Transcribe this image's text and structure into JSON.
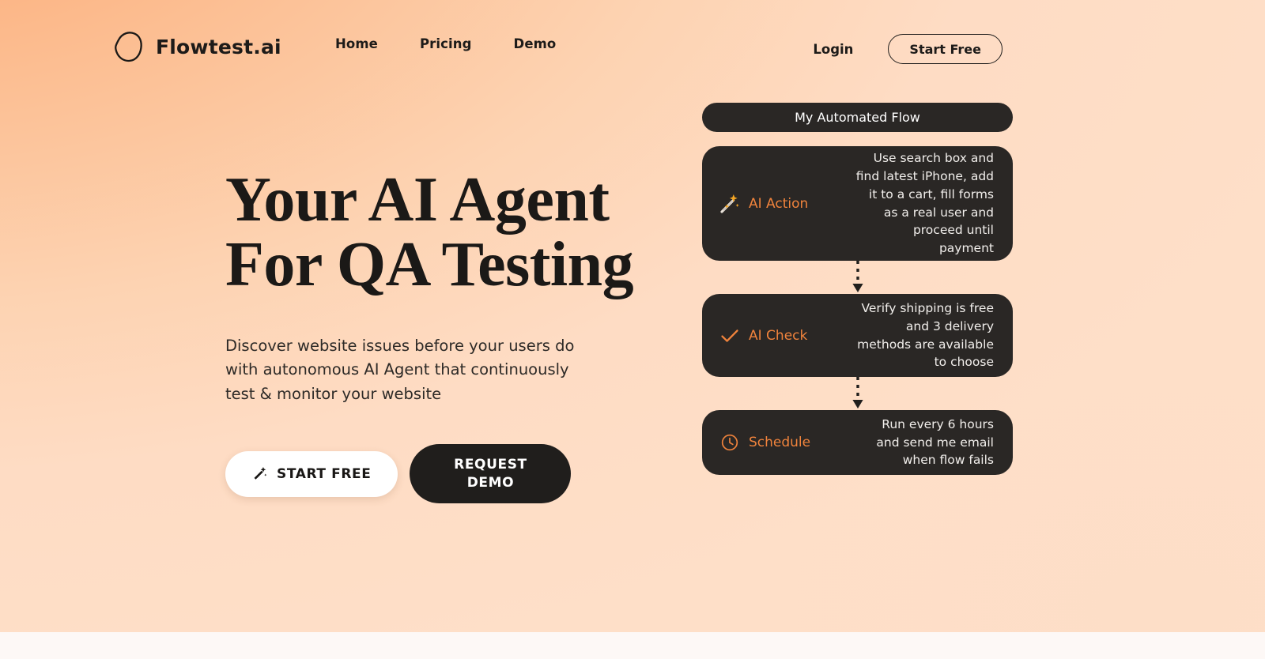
{
  "brand": {
    "name": "Flowtest.ai",
    "logo_icon": "blob-logo-icon"
  },
  "nav": {
    "items": [
      {
        "label": "Home"
      },
      {
        "label": "Pricing"
      },
      {
        "label": "Demo"
      }
    ],
    "login_label": "Login",
    "start_free_label": "Start Free"
  },
  "hero": {
    "headline_line1": "Your AI Agent",
    "headline_line2": "For QA Testing",
    "subhead": "Discover website issues before your users do with autonomous AI Agent that continuously test & monitor your website",
    "primary_cta": {
      "label": "START FREE",
      "icon": "magic-wand-icon"
    },
    "secondary_cta": {
      "label_line1": "REQUEST",
      "label_line2": "DEMO"
    }
  },
  "flow": {
    "title": "My Automated Flow",
    "nodes": [
      {
        "icon": "magic-wand-icon",
        "label": "AI Action",
        "description": "Use search box and find latest iPhone, add it to a cart, fill forms as a real user and proceed until payment"
      },
      {
        "icon": "check-icon",
        "label": "AI Check",
        "description": "Verify shipping is free and 3 delivery methods are available to choose"
      },
      {
        "icon": "clock-icon",
        "label": "Schedule",
        "description": "Run every 6 hours and send me email when flow fails"
      }
    ],
    "connector_icon": "dotted-arrow-down-icon"
  },
  "colors": {
    "background_start": "#FBA770",
    "background_end": "#FEDFC8",
    "card_dark": "#2A2725",
    "accent_orange": "#F0833C",
    "text_dark": "#1B1917",
    "below_fold": "#FDF8F6"
  }
}
